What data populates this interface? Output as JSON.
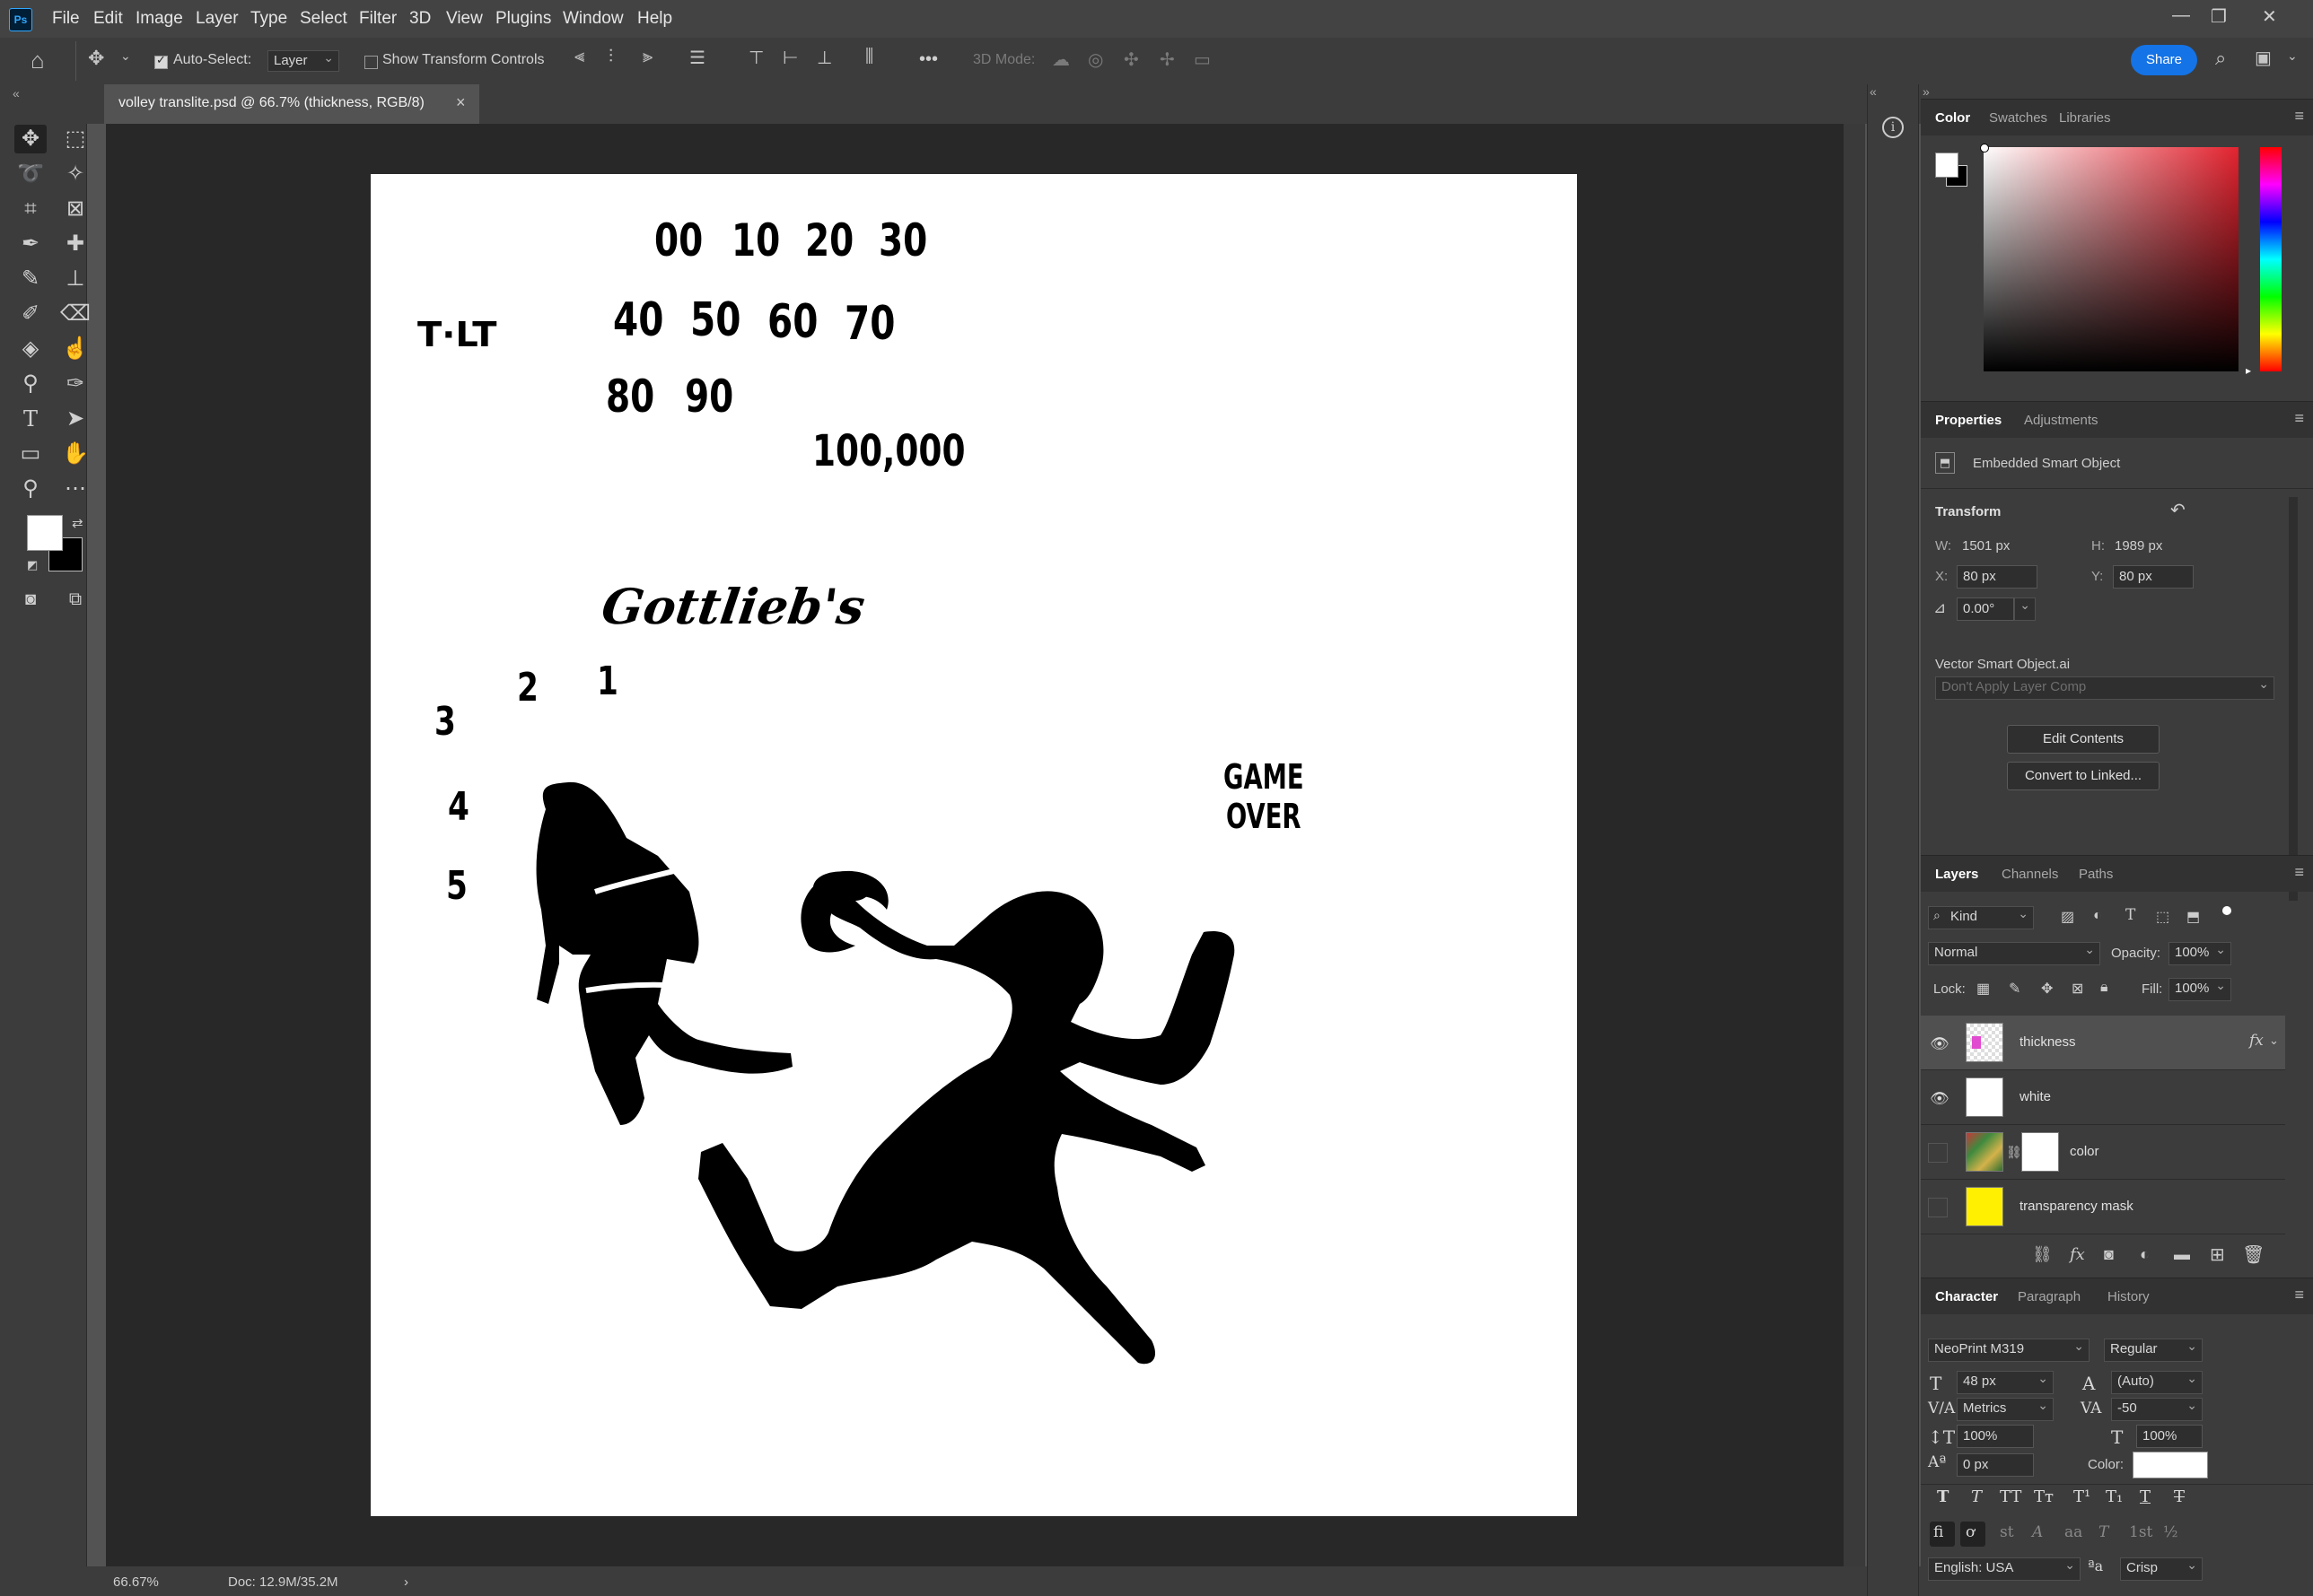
{
  "app": {
    "logo": "Ps"
  },
  "menu": [
    "File",
    "Edit",
    "Image",
    "Layer",
    "Type",
    "Select",
    "Filter",
    "3D",
    "View",
    "Plugins",
    "Window",
    "Help"
  ],
  "window_controls": {
    "minimize": "—",
    "restore": "❐",
    "close": "✕"
  },
  "options_bar": {
    "auto_select_label": "Auto-Select:",
    "auto_select_checked": true,
    "auto_select_target": "Layer",
    "show_transform_label": "Show Transform Controls",
    "show_transform_checked": false,
    "more": "•••",
    "mode_label": "3D Mode:",
    "share_label": "Share"
  },
  "document_tab": {
    "title": "volley translite.psd @ 66.7% (thickness, RGB/8)",
    "close": "×"
  },
  "status_bar": {
    "zoom": "66.67%",
    "doc": "Doc: 12.9M/35.2M",
    "arrow": "›"
  },
  "artwork": {
    "scores": [
      "00",
      "10",
      "20",
      "30",
      "40",
      "50",
      "60",
      "70",
      "80",
      "90"
    ],
    "big_score": "100,000",
    "tilt": "T·LT",
    "brand": "Gottlieb's",
    "balls": [
      "2",
      "1",
      "3",
      "4",
      "5"
    ],
    "game_over_line1": "GAME",
    "game_over_line2": "OVER"
  },
  "color_panel": {
    "tabs": [
      "Color",
      "Swatches",
      "Libraries"
    ],
    "active": "Color",
    "foreground": "#ffffff",
    "background": "#000000",
    "hue_color": "#e3232f"
  },
  "properties_panel": {
    "tabs": [
      "Properties",
      "Adjustments"
    ],
    "active": "Properties",
    "object_type": "Embedded Smart Object",
    "transform_label": "Transform",
    "w_label": "W:",
    "w_value": "1501 px",
    "h_label": "H:",
    "h_value": "1989 px",
    "x_label": "X:",
    "x_value": "80 px",
    "y_label": "Y:",
    "y_value": "80 px",
    "angle_value": "0.00°",
    "source_file": "Vector Smart Object.ai",
    "layer_comp": "Don't Apply Layer Comp",
    "edit_contents": "Edit Contents",
    "convert_linked": "Convert to Linked..."
  },
  "layers_panel": {
    "tabs": [
      "Layers",
      "Channels",
      "Paths"
    ],
    "active": "Layers",
    "filter_kind": "Kind",
    "blend_mode": "Normal",
    "opacity_label": "Opacity:",
    "opacity": "100%",
    "lock_label": "Lock:",
    "fill_label": "Fill:",
    "fill": "100%",
    "layers": [
      {
        "name": "thickness",
        "visible": true,
        "selected": true,
        "fx": "fx"
      },
      {
        "name": "white",
        "visible": true,
        "selected": false
      },
      {
        "name": "color",
        "visible": false,
        "selected": false
      },
      {
        "name": "transparency mask",
        "visible": false,
        "selected": false
      }
    ],
    "bottom_fx": "fx"
  },
  "character_panel": {
    "tabs": [
      "Character",
      "Paragraph",
      "History"
    ],
    "active": "Character",
    "font_family": "NeoPrint M319",
    "font_style": "Regular",
    "size": "48 px",
    "leading": "(Auto)",
    "kerning": "Metrics",
    "tracking": "-50",
    "vscale": "100%",
    "hscale": "100%",
    "baseline": "0 px",
    "color_label": "Color:",
    "language": "English: USA",
    "antialias": "Crisp",
    "style_buttons": [
      "T",
      "T",
      "TT",
      "Tт",
      "T¹",
      "T₁",
      "T",
      "T"
    ],
    "opentype_buttons": [
      "fi",
      "ơ",
      "st",
      "A",
      "aa",
      "T",
      "1st",
      "½"
    ]
  }
}
